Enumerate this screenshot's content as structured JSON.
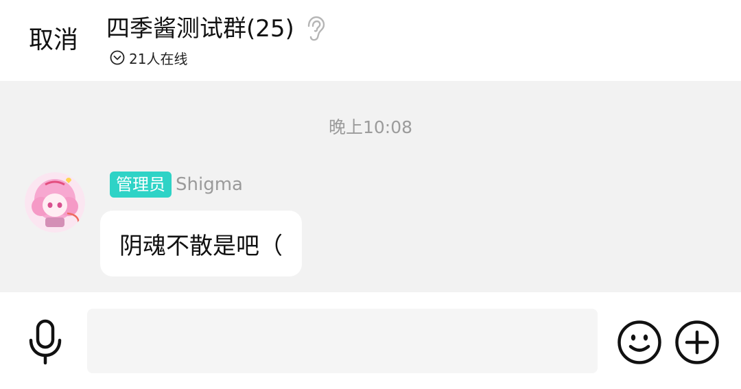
{
  "header": {
    "cancel_label": "取消",
    "title": "四季酱测试群(25)",
    "online_text": "21人在线"
  },
  "chat": {
    "timestamp": "晚上10:08",
    "message": {
      "badge": "管理员",
      "sender": "Shigma",
      "text": "阴魂不散是吧（"
    }
  },
  "input_bar": {
    "value": "",
    "placeholder": ""
  },
  "icons": {
    "ear": "ear-icon",
    "online_toggle": "chevron-down-circle-icon",
    "mic": "mic-icon",
    "emoji": "smiley-icon",
    "plus": "plus-circle-icon"
  },
  "colors": {
    "admin_badge": "#2ed3c6",
    "chat_background": "#f2f2f2",
    "bubble": "#ffffff"
  }
}
